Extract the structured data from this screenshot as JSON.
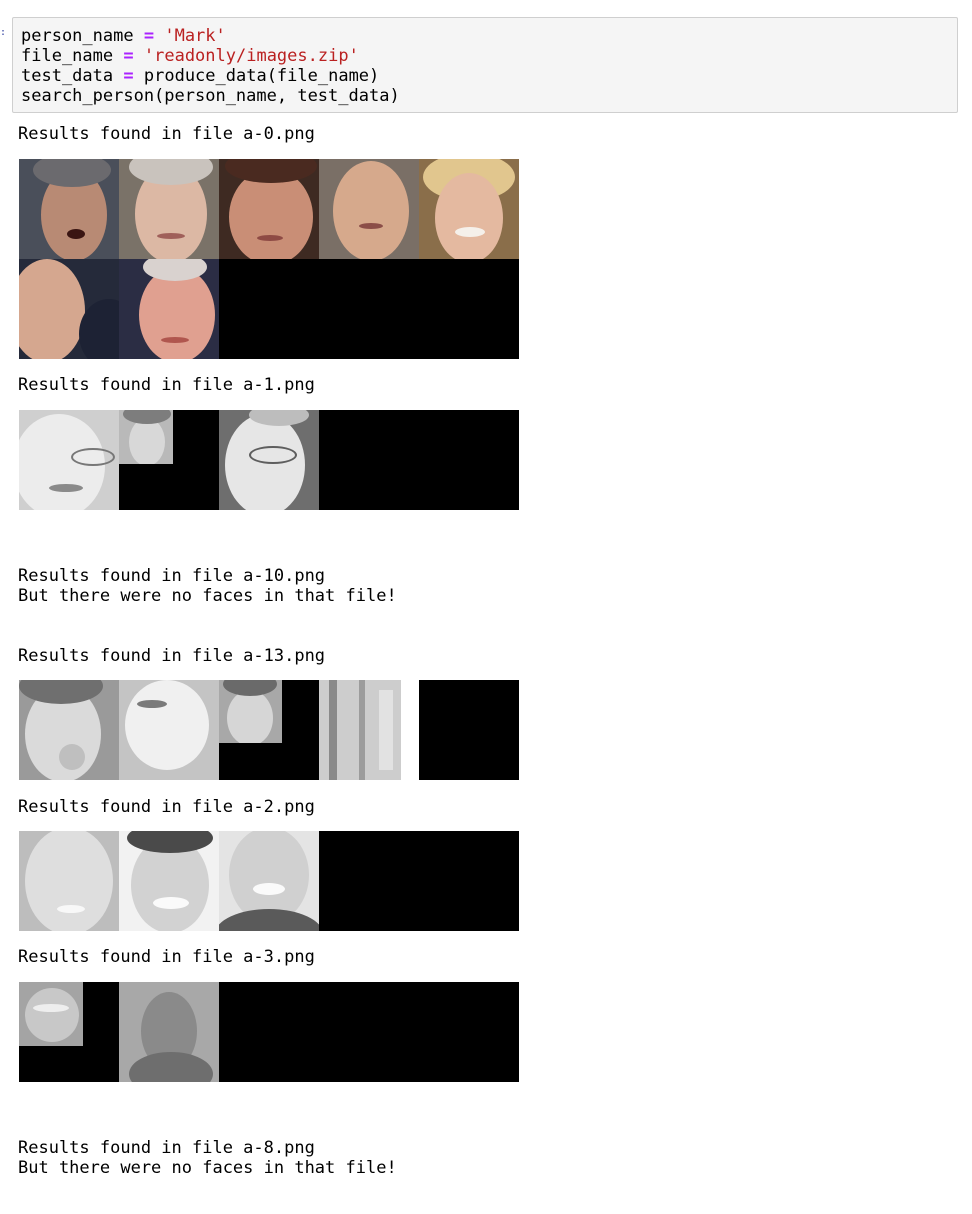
{
  "cell": {
    "lines": [
      {
        "name": "person_name",
        "op": "=",
        "value": "'Mark'"
      },
      {
        "name": "file_name",
        "op": "=",
        "value": "'readonly/images.zip'"
      },
      {
        "name": "test_data",
        "op": "=",
        "value": "produce_data(file_name)"
      },
      {
        "call": "search_person(person_name, test_data)"
      }
    ]
  },
  "results": [
    {
      "heading": "Results found in file a-0.png",
      "thumbnails": 7
    },
    {
      "heading": "Results found in file a-1.png",
      "thumbnails": 3
    },
    {
      "heading": "Results found in file a-10.png",
      "note": "But there were no faces in that file!",
      "thumbnails": 0
    },
    {
      "heading": "Results found in file a-13.png",
      "thumbnails": 5
    },
    {
      "heading": "Results found in file a-2.png",
      "thumbnails": 3
    },
    {
      "heading": "Results found in file a-3.png",
      "thumbnails": 2
    },
    {
      "heading": "Results found in file a-8.png",
      "note": "But there were no faces in that file!",
      "thumbnails": 0
    }
  ],
  "colors": {
    "operator": "#aa22ff",
    "string": "#ba2121",
    "cell_bg": "#f5f5f5",
    "grid_bg": "#000000"
  }
}
